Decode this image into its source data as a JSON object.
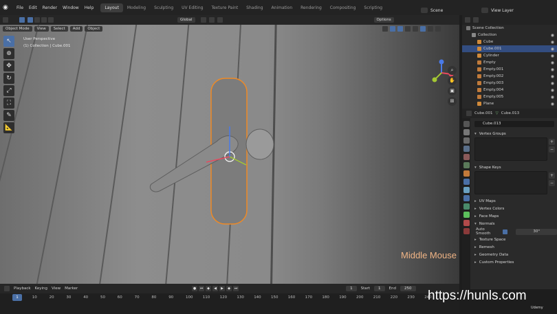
{
  "menu": [
    "File",
    "Edit",
    "Render",
    "Window",
    "Help"
  ],
  "workspaces": [
    "Layout",
    "Modeling",
    "Sculpting",
    "UV Editing",
    "Texture Paint",
    "Shading",
    "Animation",
    "Rendering",
    "Compositing",
    "Scripting"
  ],
  "active_workspace": "Layout",
  "scene_label": "Scene",
  "view_layer_label": "View Layer",
  "viewport": {
    "orientation": "Global",
    "options_label": "Options",
    "mode": "Object Mode",
    "header_menus": [
      "View",
      "Select",
      "Add",
      "Object"
    ],
    "overlay_line1": "User Perspective",
    "overlay_line2": "(1) Collection | Cube.001",
    "watermark": "Middle Mouse",
    "gizmo_axes": [
      "X",
      "Y",
      "Z"
    ]
  },
  "outliner": {
    "root": "Scene Collection",
    "items": [
      {
        "name": "Collection",
        "icon": "collection-icon",
        "selected": false
      },
      {
        "name": "Cube",
        "icon": "mesh-icon",
        "selected": false
      },
      {
        "name": "Cube.001",
        "icon": "mesh-icon",
        "selected": true
      },
      {
        "name": "Cylinder",
        "icon": "mesh-icon",
        "selected": false
      },
      {
        "name": "Empty",
        "icon": "empty-icon",
        "selected": false
      },
      {
        "name": "Empty.001",
        "icon": "empty-icon",
        "selected": false
      },
      {
        "name": "Empty.002",
        "icon": "empty-icon",
        "selected": false
      },
      {
        "name": "Empty.003",
        "icon": "empty-icon",
        "selected": false
      },
      {
        "name": "Empty.004",
        "icon": "empty-icon",
        "selected": false
      },
      {
        "name": "Empty.005",
        "icon": "empty-icon",
        "selected": false
      },
      {
        "name": "Plane",
        "icon": "mesh-icon",
        "selected": false
      }
    ]
  },
  "properties": {
    "object_name": "Cube.001",
    "mesh_name": "Cube.013",
    "data_field": "Cube.013",
    "panels": {
      "vertex_groups": "Vertex Groups",
      "shape_keys": "Shape Keys",
      "uv_maps": "UV Maps",
      "vertex_colors": "Vertex Colors",
      "face_maps": "Face Maps",
      "normals": "Normals",
      "auto_smooth": "Auto Smooth",
      "auto_smooth_angle": "30°",
      "texture_space": "Texture Space",
      "remesh": "Remesh",
      "geometry_data": "Geometry Data",
      "custom_properties": "Custom Properties"
    }
  },
  "timeline": {
    "menus": [
      "Playback",
      "Keying",
      "View",
      "Marker"
    ],
    "current_frame": "1",
    "start_label": "Start",
    "start_value": "1",
    "end_label": "End",
    "end_value": "250",
    "ticks": [
      "1",
      "10",
      "20",
      "30",
      "40",
      "50",
      "60",
      "70",
      "80",
      "90",
      "100",
      "110",
      "120",
      "130",
      "140",
      "150",
      "160",
      "170",
      "180",
      "190",
      "200",
      "210",
      "220",
      "230",
      "240"
    ]
  },
  "site_watermark": "https://hunls.com",
  "udemy_label": "Udemy",
  "colors": {
    "selection": "#334d80",
    "accent": "#4a6fa5",
    "outline": "#f08a24",
    "watermark": "#f0b485"
  }
}
